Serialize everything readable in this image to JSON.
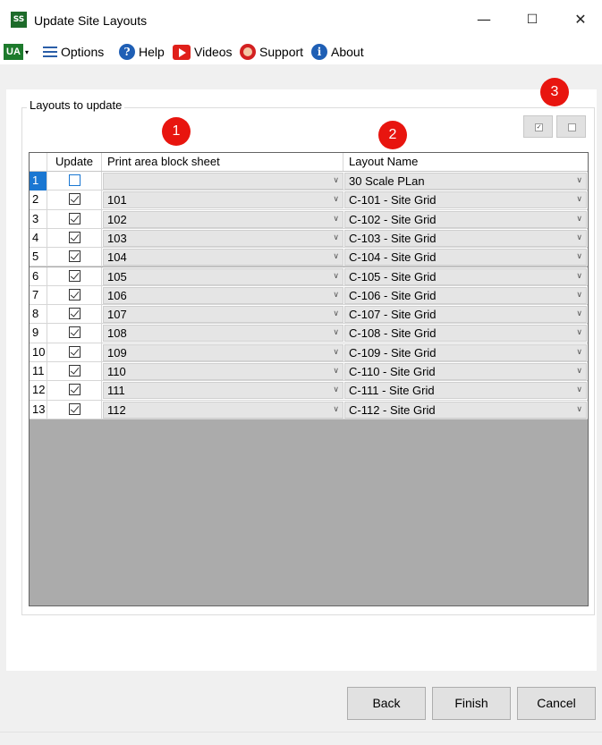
{
  "window": {
    "title": "Update Site Layouts",
    "app_icon_text": "SS",
    "minimize": "—",
    "maximize": "☐",
    "close": "✕"
  },
  "toolbar": {
    "ua_label": "UA",
    "ua_caret": "▾",
    "options": "Options",
    "help": "Help",
    "videos": "Videos",
    "support": "Support",
    "about": "About"
  },
  "group": {
    "label": "Layouts to update"
  },
  "badges": [
    "1",
    "2",
    "3"
  ],
  "grid": {
    "headers": {
      "update": "Update",
      "print_area": "Print area block sheet",
      "layout_name": "Layout Name"
    },
    "rows": [
      {
        "num": "1",
        "checked": false,
        "print": "",
        "layout": "30 Scale PLan"
      },
      {
        "num": "2",
        "checked": true,
        "print": "101",
        "layout": "C-101 - Site Grid"
      },
      {
        "num": "3",
        "checked": true,
        "print": "102",
        "layout": "C-102 - Site Grid"
      },
      {
        "num": "4",
        "checked": true,
        "print": "103",
        "layout": "C-103 - Site Grid"
      },
      {
        "num": "5",
        "checked": true,
        "print": "104",
        "layout": "C-104 - Site Grid"
      },
      {
        "num": "6",
        "checked": true,
        "print": "105",
        "layout": "C-105 - Site Grid"
      },
      {
        "num": "7",
        "checked": true,
        "print": "106",
        "layout": "C-106 - Site Grid"
      },
      {
        "num": "8",
        "checked": true,
        "print": "107",
        "layout": "C-107 - Site Grid"
      },
      {
        "num": "9",
        "checked": true,
        "print": "108",
        "layout": "C-108 - Site Grid"
      },
      {
        "num": "10",
        "checked": true,
        "print": "109",
        "layout": "C-109 - Site Grid"
      },
      {
        "num": "11",
        "checked": true,
        "print": "110",
        "layout": "C-110 - Site Grid"
      },
      {
        "num": "12",
        "checked": true,
        "print": "111",
        "layout": "C-111 - Site Grid"
      },
      {
        "num": "13",
        "checked": true,
        "print": "112",
        "layout": "C-112 - Site Grid"
      }
    ]
  },
  "buttons": {
    "back": "Back",
    "finish": "Finish",
    "cancel": "Cancel"
  },
  "colors": {
    "badge": "#e8150f",
    "selection": "#1a77d2",
    "grid_empty": "#ababab"
  }
}
